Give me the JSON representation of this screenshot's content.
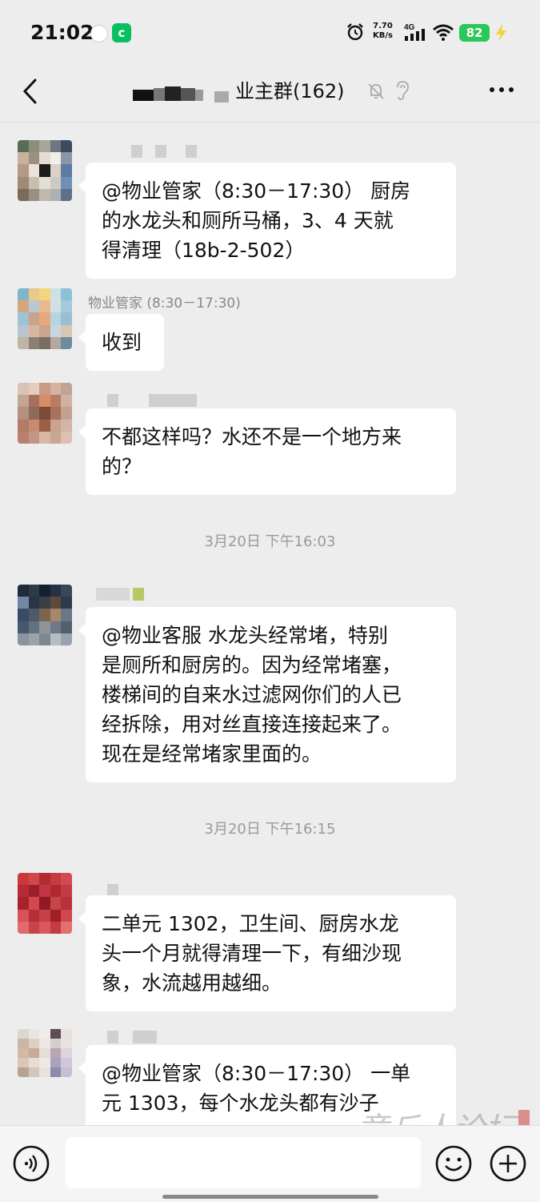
{
  "status_bar": {
    "time": "21:02",
    "network_speed_value": "7.70",
    "network_speed_unit": "KB/s",
    "network_type": "4G",
    "battery": "82",
    "icons": [
      "alarm-icon",
      "signal-icon",
      "wifi-icon",
      "battery-icon",
      "charging-icon"
    ]
  },
  "nav": {
    "title": "业主群(162)",
    "icons": [
      "back-icon",
      "mute-icon",
      "ear-icon",
      "more-icon"
    ]
  },
  "messages": [
    {
      "sender": "",
      "text_lines": [
        "@物业管家（8:30－17:30） 厨房",
        "的水龙头和厕所马桶，3、4 天就",
        "得清理（18b-2-502）"
      ]
    },
    {
      "sender": "物业管家 (8:30－17:30)",
      "text_lines": [
        "收到"
      ]
    },
    {
      "sender": "",
      "text_lines": [
        "不都这样吗？水还不是一个地方来",
        "的？"
      ]
    },
    {
      "sender": "",
      "text_lines": [
        "@物业客服  水龙头经常堵，特别",
        "是厕所和厨房的。因为经常堵塞，",
        "楼梯间的自来水过滤网你们的人已",
        "经拆除，用对丝直接连接起来了。",
        "现在是经常堵家里面的。"
      ]
    },
    {
      "sender": "",
      "text_lines": [
        "二单元 1302，卫生间、厨房水龙",
        "头一个月就得清理一下，有细沙现",
        "象，水流越用越细。"
      ]
    },
    {
      "sender": "",
      "text_lines": [
        "@物业管家（8:30－17:30） 一单",
        "元 1303，每个水龙头都有沙子"
      ]
    }
  ],
  "timestamps": [
    "3月20日 下午16:03",
    "3月20日 下午16:15"
  ],
  "input_bar": {
    "placeholder": "",
    "icons": [
      "voice-icon",
      "emoji-icon",
      "plus-icon"
    ]
  },
  "watermark": {
    "text": "章丘人论坛"
  },
  "colors": {
    "background": "#ededed",
    "bubble": "#ffffff",
    "battery": "#2bc75a",
    "wechat_green": "#07c160",
    "timestamp_text": "#9a9a9a"
  }
}
